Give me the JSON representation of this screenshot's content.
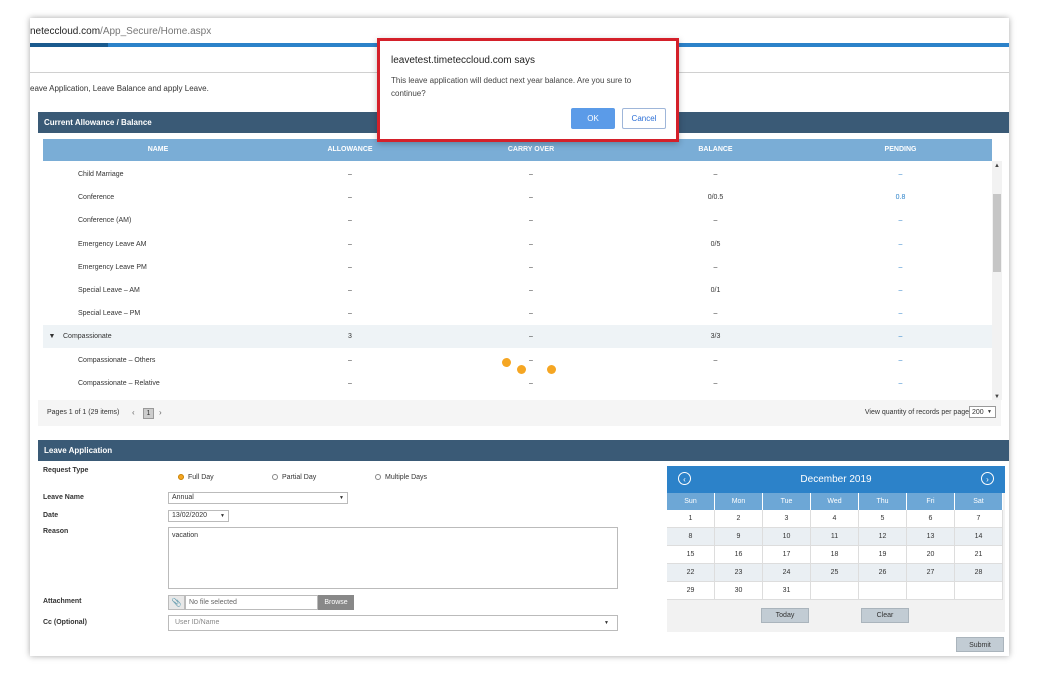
{
  "browser": {
    "host": "neteccloud.com",
    "path": "/App_Secure/Home.aspx"
  },
  "page": {
    "description": "eave Application, Leave Balance and apply Leave."
  },
  "balance": {
    "title": "Current Allowance / Balance",
    "columns": [
      "NAME",
      "ALLOWANCE",
      "CARRY OVER",
      "BALANCE",
      "PENDING"
    ],
    "rows": [
      {
        "name": "Child Marriage",
        "allowance": "–",
        "carry": "–",
        "balance": "–",
        "pending": "–"
      },
      {
        "name": "Conference",
        "allowance": "–",
        "carry": "–",
        "balance": "0/0.5",
        "pending": "0.8"
      },
      {
        "name": "Conference (AM)",
        "allowance": "–",
        "carry": "–",
        "balance": "–",
        "pending": "–"
      },
      {
        "name": "Emergency Leave AM",
        "allowance": "–",
        "carry": "–",
        "balance": "0/5",
        "pending": "–"
      },
      {
        "name": "Emergency Leave PM",
        "allowance": "–",
        "carry": "–",
        "balance": "–",
        "pending": "–"
      },
      {
        "name": "Special Leave – AM",
        "allowance": "–",
        "carry": "–",
        "balance": "0/1",
        "pending": "–"
      },
      {
        "name": "Special Leave – PM",
        "allowance": "–",
        "carry": "–",
        "balance": "–",
        "pending": "–"
      },
      {
        "name": "Compassionate",
        "allowance": "3",
        "carry": "–",
        "balance": "3/3",
        "pending": "–",
        "group": true,
        "toggle": "▼"
      },
      {
        "name": "Compassionate – Others",
        "allowance": "–",
        "carry": "–",
        "balance": "–",
        "pending": "–"
      },
      {
        "name": "Compassionate – Relative",
        "allowance": "–",
        "carry": "–",
        "balance": "–",
        "pending": "–"
      }
    ],
    "pager": {
      "info": "Pages 1 of 1 (29 items)",
      "prev": "‹",
      "page": "1",
      "next": "›",
      "qty_label": "View quantity of records per page",
      "qty_value": "200"
    },
    "scroll": {
      "up": "▲",
      "down": "▼"
    }
  },
  "leave": {
    "title": "Leave Application",
    "request_type_label": "Request Type",
    "options": [
      "Full Day",
      "Partial Day",
      "Multiple Days"
    ],
    "selected_option": "Full Day",
    "leave_name_label": "Leave Name",
    "leave_name_value": "Annual",
    "date_label": "Date",
    "date_value": "13/02/2020",
    "reason_label": "Reason",
    "reason_value": "vacation",
    "attachment_label": "Attachment",
    "attachment_placeholder": "No file selected",
    "browse_label": "Browse",
    "cc_label": "Cc (Optional)",
    "cc_placeholder": "User ID/Name",
    "submit_label": "Submit",
    "caret": "▼",
    "clip_icon": "📎"
  },
  "calendar": {
    "title": "December 2019",
    "prev_icon": "‹",
    "next_icon": "›",
    "days_of_week": [
      "Sun",
      "Mon",
      "Tue",
      "Wed",
      "Thu",
      "Fri",
      "Sat"
    ],
    "weeks": [
      [
        "1",
        "2",
        "3",
        "4",
        "5",
        "6",
        "7"
      ],
      [
        "8",
        "9",
        "10",
        "11",
        "12",
        "13",
        "14"
      ],
      [
        "15",
        "16",
        "17",
        "18",
        "19",
        "20",
        "21"
      ],
      [
        "22",
        "23",
        "24",
        "25",
        "26",
        "27",
        "28"
      ],
      [
        "29",
        "30",
        "31",
        "",
        "",
        "",
        ""
      ]
    ],
    "today_label": "Today",
    "clear_label": "Clear"
  },
  "dialog": {
    "title": "leavetest.timeteccloud.com says",
    "message": "This leave application will deduct next year balance. Are you sure to continue?",
    "ok_label": "OK",
    "cancel_label": "Cancel"
  },
  "colors": {
    "header": "#3a5a76",
    "grid_header": "#7aadd6",
    "accent": "#2c82c9",
    "dialog_border": "#d4202a",
    "spinner": "#f5a623"
  }
}
